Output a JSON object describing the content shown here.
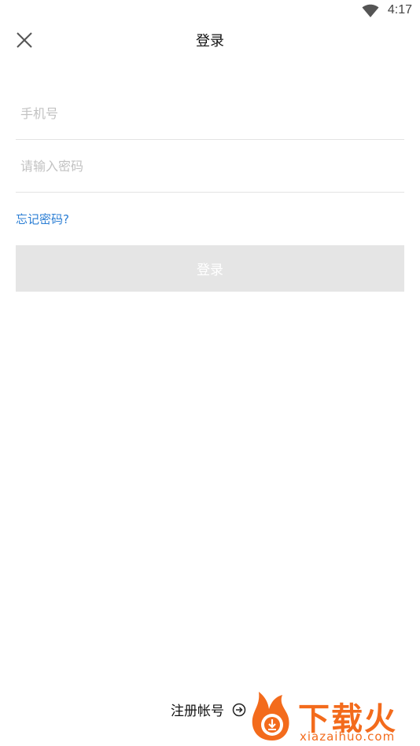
{
  "status_bar": {
    "time": "4:17",
    "wifi_icon": "wifi-icon"
  },
  "nav": {
    "title": "登录",
    "close_icon": "close-icon"
  },
  "form": {
    "phone_placeholder": "手机号",
    "phone_value": "",
    "password_placeholder": "请输入密码",
    "password_value": "",
    "forgot_label": "忘记密码?",
    "login_label": "登录"
  },
  "footer": {
    "register_label": "注册帐号",
    "register_icon": "arrow-right-circle-icon"
  },
  "watermark": {
    "brand": "下载火",
    "url": "xiazaihuo.com",
    "logo_icon": "download-logo-icon"
  },
  "colors": {
    "link": "#2b7ed4",
    "button_disabled_bg": "#e5e5e5",
    "divider": "#e3e3e3",
    "watermark": "#f36b1c"
  }
}
